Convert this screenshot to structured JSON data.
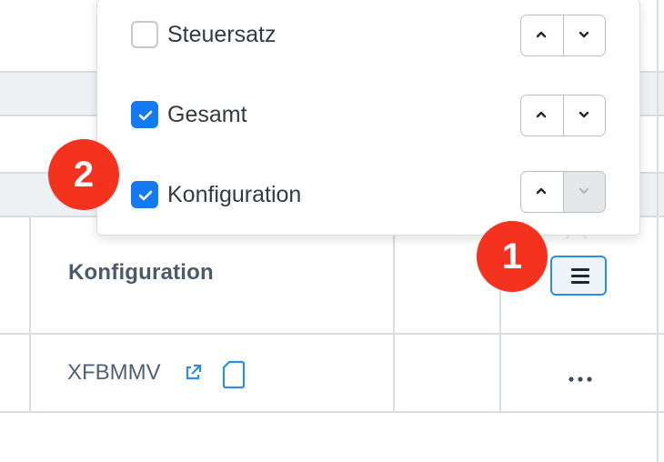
{
  "table": {
    "column_title": "Konfiguration",
    "row_value": "XFBMMV"
  },
  "column_menu": {
    "items": [
      {
        "label": "Steuersatz",
        "checked": false,
        "up_disabled": false,
        "down_disabled": false
      },
      {
        "label": "Gesamt",
        "checked": true,
        "up_disabled": false,
        "down_disabled": false
      },
      {
        "label": "Konfiguration",
        "checked": true,
        "up_disabled": false,
        "down_disabled": true
      }
    ]
  },
  "annotations": {
    "badge_1": "1",
    "badge_2": "2"
  },
  "icons": {
    "menu_button": "hamburger-icon",
    "external_link": "external-link-icon",
    "copy": "document-icon",
    "row_actions": "ellipsis-icon"
  },
  "colors": {
    "accent": "#1479f2",
    "badge": "#f5321e",
    "link": "#2d8ce5"
  }
}
